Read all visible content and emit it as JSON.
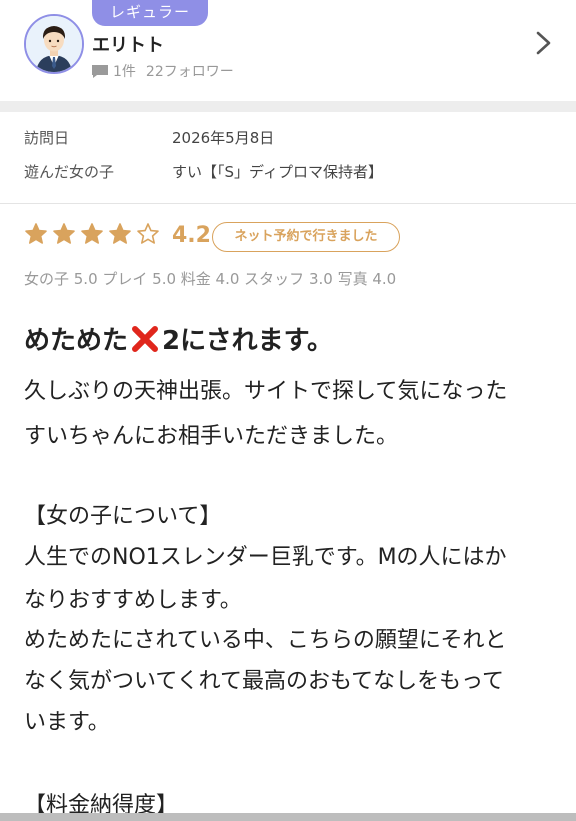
{
  "reviewer": {
    "rank_badge": "レギュラー",
    "name": "エリトト",
    "review_count": "1件",
    "followers": "22フォロワー",
    "avatar_icon": "user-avatar-icon",
    "chevron_icon": "chevron-right-icon"
  },
  "visit": {
    "date_label": "訪問日",
    "date_value": "2026年5月8日",
    "girl_label": "遊んだ女の子",
    "girl_value": "すい【「S」ディプロマ保持者】"
  },
  "rating": {
    "stars": 4,
    "max_stars": 5,
    "score": "4.2",
    "booking_badge": "ネット予約で行きました",
    "sub_scores": "女の子 5.0 プレイ 5.0 料金 4.0 スタッフ 3.0 写真 4.0",
    "star_color": "#d9a35d"
  },
  "review": {
    "title_before": "めためた",
    "title_icon": "cross-mark-icon",
    "title_after": "2にされます。",
    "lines": [
      "久しぶりの天神出張。サイトで探して気になった",
      "すいちゃんにお相手いただきました。",
      "【女の子について】",
      "人生でのNO1スレンダー巨乳です。Mの人にはか",
      "なりおすすめします。",
      "めためたにされている中、こちらの願望にそれと",
      "なく気がついてくれて最高のおもてなしをもって",
      "います。",
      "【料金納得度】"
    ]
  }
}
